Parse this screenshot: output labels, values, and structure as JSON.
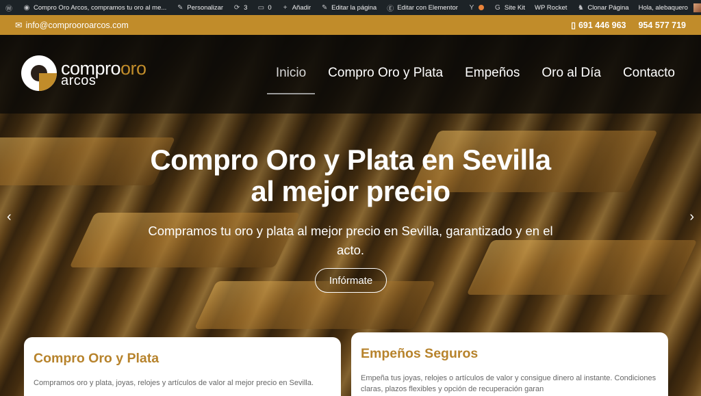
{
  "adminbar": {
    "site_title": "Compro Oro Arcos, compramos tu oro al me...",
    "personalizar": "Personalizar",
    "updates_count": "3",
    "comments_count": "0",
    "add_new": "Añadir",
    "edit_page": "Editar la página",
    "edit_elementor": "Editar con Elementor",
    "site_kit": "Site Kit",
    "wp_rocket": "WP Rocket",
    "clone_page": "Clonar Página",
    "greeting": "Hola, alebaquero"
  },
  "topbar": {
    "email": "info@comprooroarcos.com",
    "phone1": "691 446 963",
    "phone2": "954 577 719"
  },
  "logo": {
    "compro": "compro",
    "oro": "oro",
    "arcos": "arcos"
  },
  "nav": {
    "items": [
      {
        "label": "Inicio"
      },
      {
        "label": "Compro Oro y Plata"
      },
      {
        "label": "Empeños"
      },
      {
        "label": "Oro al Día"
      },
      {
        "label": "Contacto"
      }
    ]
  },
  "hero": {
    "title_line1": "Compro Oro y Plata en Sevilla",
    "title_line2": "al mejor precio",
    "subtitle": "Compramos tu oro y plata al mejor precio en Sevilla, garantizado y en el acto.",
    "cta": "Infórmate"
  },
  "cards": [
    {
      "title": "Compro Oro y Plata",
      "text": "Compramos oro y plata, joyas, relojes y artículos de valor al mejor precio en Sevilla."
    },
    {
      "title": "Empeños Seguros",
      "text": "Empeña tus joyas, relojes o artículos de valor y consigue dinero al instante. Condiciones claras, plazos flexibles y opción de recuperación garan"
    }
  ],
  "colors": {
    "accent": "#c18c2a",
    "adminbar": "#1d2327"
  }
}
